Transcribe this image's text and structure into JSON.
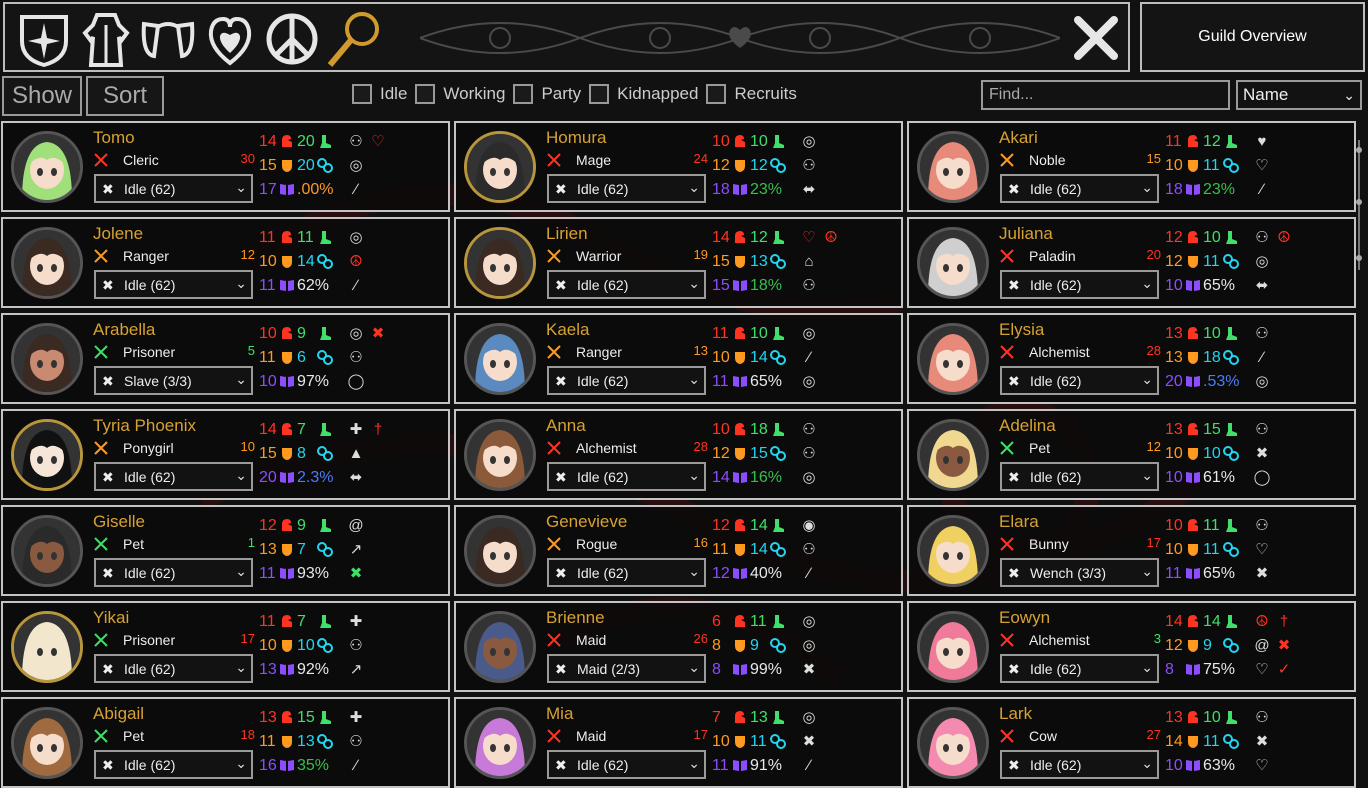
{
  "toolbar": {
    "icons": [
      "guild-compass-icon",
      "outfit-icon",
      "restraints-icon",
      "heart-lock-icon",
      "peace-icon",
      "magnifier-icon"
    ],
    "close_icon": "close-icon"
  },
  "guild_overview_label": "Guild Overview",
  "show_label": "Show",
  "sort_label": "Sort",
  "filters": [
    "Idle",
    "Working",
    "Party",
    "Kidnapped",
    "Recruits"
  ],
  "find_placeholder": "Find...",
  "sort_value": "Name",
  "colors": {
    "name": "#d6a233",
    "str": "#ff3322",
    "con": "#ff9a1f",
    "int": "#8c4dff",
    "agi": "#3ee06a",
    "dex": "#22d4f0"
  },
  "characters": [
    {
      "name": "Tomo",
      "class": "Cleric",
      "class_icon": "cleric-icon",
      "level": "30",
      "level_color": "#ff3322",
      "job": "Idle (62)",
      "str": "14",
      "agi": "20",
      "con": "15",
      "dex": "20",
      "int": "17",
      "pct": ".00%",
      "pct_color": "#ff9a1f",
      "icons": [
        "bound-figure",
        "target",
        "brush"
      ],
      "icons2": [
        "heart-lock"
      ]
    },
    {
      "name": "Homura",
      "class": "Mage",
      "class_icon": "mage-icon",
      "level": "24",
      "level_color": "#ff3322",
      "job": "Idle (62)",
      "str": "10",
      "agi": "10",
      "con": "12",
      "dex": "12",
      "int": "18",
      "pct": "23%",
      "pct_color": "#35c04a",
      "icons": [
        "target",
        "bound-figure",
        "dumbbell"
      ],
      "icons2": []
    },
    {
      "name": "Akari",
      "class": "Noble",
      "class_icon": "noble-icon",
      "level": "15",
      "level_color": "#ff9a1f",
      "job": "Idle (62)",
      "str": "11",
      "agi": "12",
      "con": "10",
      "dex": "11",
      "int": "18",
      "pct": "23%",
      "pct_color": "#35c04a",
      "icons": [
        "heart",
        "heart-outline",
        "brush"
      ],
      "icons2": []
    },
    {
      "name": "Jolene",
      "class": "Ranger",
      "class_icon": "ranger-icon",
      "level": "12",
      "level_color": "#ff9a1f",
      "job": "Idle (62)",
      "str": "11",
      "agi": "11",
      "con": "10",
      "dex": "14",
      "int": "11",
      "pct": "62%",
      "pct_color": "#e8e8e8",
      "icons": [
        "target",
        "peace",
        "brush"
      ],
      "icons2": []
    },
    {
      "name": "Lirien",
      "class": "Warrior",
      "class_icon": "warrior-icon",
      "level": "19",
      "level_color": "#ff9a1f",
      "job": "Idle (62)",
      "str": "14",
      "agi": "12",
      "con": "15",
      "dex": "13",
      "int": "15",
      "pct": "18%",
      "pct_color": "#35c04a",
      "icons": [
        "heart-lock",
        "shirt",
        "bound-figure"
      ],
      "icons2": [
        "peace"
      ]
    },
    {
      "name": "Juliana",
      "class": "Paladin",
      "class_icon": "paladin-icon",
      "level": "20",
      "level_color": "#ff3322",
      "job": "Idle (62)",
      "str": "12",
      "agi": "10",
      "con": "12",
      "dex": "11",
      "int": "10",
      "pct": "65%",
      "pct_color": "#e8e8e8",
      "icons": [
        "bound-figure",
        "target",
        "dumbbell"
      ],
      "icons2": [
        "peace"
      ]
    },
    {
      "name": "Arabella",
      "class": "Prisoner",
      "class_icon": "prisoner-icon",
      "level": "5",
      "level_color": "#3ee06a",
      "job": "Slave (3/3)",
      "str": "10",
      "agi": "9",
      "con": "11",
      "dex": "6",
      "int": "10",
      "pct": "97%",
      "pct_color": "#e8e8e8",
      "icons": [
        "target",
        "bound-figure",
        "collar"
      ],
      "icons2": [
        "prisoner"
      ]
    },
    {
      "name": "Kaela",
      "class": "Ranger",
      "class_icon": "ranger-icon",
      "level": "13",
      "level_color": "#ff9a1f",
      "job": "Idle (62)",
      "str": "11",
      "agi": "10",
      "con": "10",
      "dex": "14",
      "int": "11",
      "pct": "65%",
      "pct_color": "#e8e8e8",
      "icons": [
        "target",
        "brush",
        "target"
      ],
      "icons2": []
    },
    {
      "name": "Elysia",
      "class": "Alchemist",
      "class_icon": "alchemist-icon",
      "level": "28",
      "level_color": "#ff3322",
      "job": "Idle (62)",
      "str": "13",
      "agi": "10",
      "con": "13",
      "dex": "18",
      "int": "20",
      "pct": ".53%",
      "pct_color": "#4a7bff",
      "icons": [
        "bound-figure",
        "brush",
        "target"
      ],
      "icons2": []
    },
    {
      "name": "Tyria Phoenix",
      "class": "Ponygirl",
      "class_icon": "ponygirl-icon",
      "level": "10",
      "level_color": "#ff9a1f",
      "job": "Idle (62)",
      "str": "14",
      "agi": "7",
      "con": "15",
      "dex": "8",
      "int": "20",
      "pct": "2.3%",
      "pct_color": "#4a7bff",
      "icons": [
        "plus",
        "poop",
        "dumbbell"
      ],
      "icons2": [
        "candle"
      ]
    },
    {
      "name": "Anna",
      "class": "Alchemist",
      "class_icon": "alchemist-icon",
      "level": "28",
      "level_color": "#ff3322",
      "job": "Idle (62)",
      "str": "10",
      "agi": "18",
      "con": "12",
      "dex": "15",
      "int": "14",
      "pct": "16%",
      "pct_color": "#35c04a",
      "icons": [
        "bound-figure",
        "bound-figure",
        "target"
      ],
      "icons2": []
    },
    {
      "name": "Adelina",
      "class": "Pet",
      "class_icon": "pet-icon",
      "level": "12",
      "level_color": "#ff9a1f",
      "job": "Idle (62)",
      "str": "13",
      "agi": "15",
      "con": "10",
      "dex": "10",
      "int": "10",
      "pct": "61%",
      "pct_color": "#e8e8e8",
      "icons": [
        "bound-figure",
        "crossed-tools",
        "collar"
      ],
      "icons2": []
    },
    {
      "name": "Giselle",
      "class": "Pet",
      "class_icon": "pet-icon",
      "level": "1",
      "level_color": "#3ee06a",
      "job": "Idle (62)",
      "str": "12",
      "agi": "9",
      "con": "13",
      "dex": "7",
      "int": "11",
      "pct": "93%",
      "pct_color": "#e8e8e8",
      "icons": [
        "spiral",
        "syringe",
        "cross-green"
      ],
      "icons2": []
    },
    {
      "name": "Genevieve",
      "class": "Rogue",
      "class_icon": "rogue-icon",
      "level": "16",
      "level_color": "#ff9a1f",
      "job": "Idle (62)",
      "str": "12",
      "agi": "14",
      "con": "11",
      "dex": "14",
      "int": "12",
      "pct": "40%",
      "pct_color": "#e8e8e8",
      "icons": [
        "pot",
        "bound-figure",
        "brush"
      ],
      "icons2": []
    },
    {
      "name": "Elara",
      "class": "Bunny",
      "class_icon": "bunny-icon",
      "level": "17",
      "level_color": "#ff3322",
      "job": "Wench (3/3)",
      "str": "10",
      "agi": "11",
      "con": "10",
      "dex": "11",
      "int": "11",
      "pct": "65%",
      "pct_color": "#e8e8e8",
      "icons": [
        "bound-figure",
        "heart-outline",
        "cross"
      ],
      "icons2": []
    },
    {
      "name": "Yikai",
      "class": "Prisoner",
      "class_icon": "prisoner-icon",
      "level": "17",
      "level_color": "#ff3322",
      "job": "Idle (62)",
      "str": "11",
      "agi": "7",
      "con": "10",
      "dex": "10",
      "int": "13",
      "pct": "92%",
      "pct_color": "#e8e8e8",
      "icons": [
        "plus",
        "bound-figure",
        "syringe"
      ],
      "icons2": []
    },
    {
      "name": "Brienne",
      "class": "Maid",
      "class_icon": "maid-icon",
      "level": "26",
      "level_color": "#ff3322",
      "job": "Maid (2/3)",
      "str": "6",
      "agi": "11",
      "con": "8",
      "dex": "9",
      "int": "8",
      "pct": "99%",
      "pct_color": "#e8e8e8",
      "icons": [
        "target",
        "target",
        "cross"
      ],
      "icons2": []
    },
    {
      "name": "Eowyn",
      "class": "Alchemist",
      "class_icon": "alchemist-icon",
      "level": "3",
      "level_color": "#3ee06a",
      "job": "Idle (62)",
      "str": "14",
      "agi": "14",
      "con": "12",
      "dex": "9",
      "int": "8",
      "pct": "75%",
      "pct_color": "#e8e8e8",
      "icons": [
        "peace",
        "spiral",
        "heart-outline"
      ],
      "icons2": [
        "candle",
        "cross-red",
        "check-red"
      ]
    },
    {
      "name": "Abigail",
      "class": "Pet",
      "class_icon": "pet-icon",
      "level": "18",
      "level_color": "#ff3322",
      "job": "Idle (62)",
      "str": "13",
      "agi": "15",
      "con": "11",
      "dex": "13",
      "int": "16",
      "pct": "35%",
      "pct_color": "#35c04a",
      "icons": [
        "plus",
        "bound-figure",
        "brush"
      ],
      "icons2": []
    },
    {
      "name": "Mia",
      "class": "Maid",
      "class_icon": "maid-icon",
      "level": "17",
      "level_color": "#ff3322",
      "job": "Idle (62)",
      "str": "7",
      "agi": "13",
      "con": "10",
      "dex": "11",
      "int": "11",
      "pct": "91%",
      "pct_color": "#e8e8e8",
      "icons": [
        "target",
        "crossed-tools",
        "brush"
      ],
      "icons2": []
    },
    {
      "name": "Lark",
      "class": "Cow",
      "class_icon": "cow-icon",
      "level": "27",
      "level_color": "#ff3322",
      "job": "Idle (62)",
      "str": "13",
      "agi": "10",
      "con": "14",
      "dex": "11",
      "int": "10",
      "pct": "63%",
      "pct_color": "#e8e8e8",
      "icons": [
        "bound-figure",
        "crossed-tools",
        "heart-outline"
      ],
      "icons2": []
    }
  ]
}
